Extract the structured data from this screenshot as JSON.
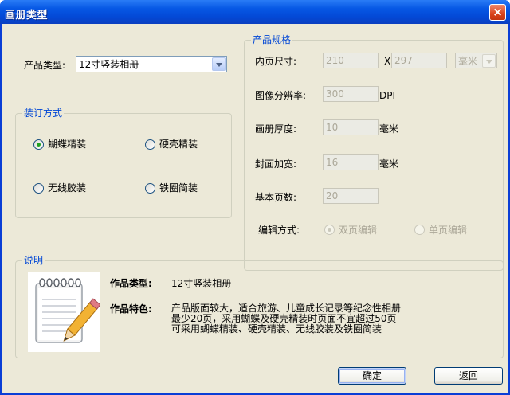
{
  "window": {
    "title": "画册类型",
    "close_glyph": "×"
  },
  "product_type": {
    "label": "产品类型:",
    "value": "12寸竖装相册"
  },
  "binding": {
    "title": "装订方式",
    "options": [
      {
        "label": "蝴蝶精装",
        "selected": true
      },
      {
        "label": "硬壳精装",
        "selected": false
      },
      {
        "label": "无线胶装",
        "selected": false
      },
      {
        "label": "铁圈简装",
        "selected": false
      }
    ]
  },
  "spec": {
    "title": "产品规格",
    "inner_size_label": "内页尺寸:",
    "width": "210",
    "x_sep": "X",
    "height": "297",
    "unit_select": "毫米",
    "resolution_label": "图像分辨率:",
    "resolution": "300",
    "resolution_unit": "DPI",
    "thickness_label": "画册厚度:",
    "thickness": "10",
    "thickness_unit": "毫米",
    "cover_label": "封面加宽:",
    "cover": "16",
    "cover_unit": "毫米",
    "pages_label": "基本页数:",
    "pages": "20",
    "edit_mode_label": "编辑方式:",
    "edit_modes": [
      {
        "label": "双页编辑",
        "selected": true
      },
      {
        "label": "单页编辑",
        "selected": false
      }
    ]
  },
  "description": {
    "title": "说明",
    "icon": "notepad-pencil-icon",
    "type_label": "作品类型:",
    "type_value": "12寸竖装相册",
    "features_label": "作品特色:",
    "features_lines": [
      "产品版面较大，适合旅游、儿童成长记录等纪念性相册",
      "最少20页，采用蝴蝶及硬壳精装时页面不宜超过50页",
      "可采用蝴蝶精装、硬壳精装、无线胶装及铁圈简装"
    ]
  },
  "buttons": {
    "ok": "确定",
    "back": "返回"
  }
}
